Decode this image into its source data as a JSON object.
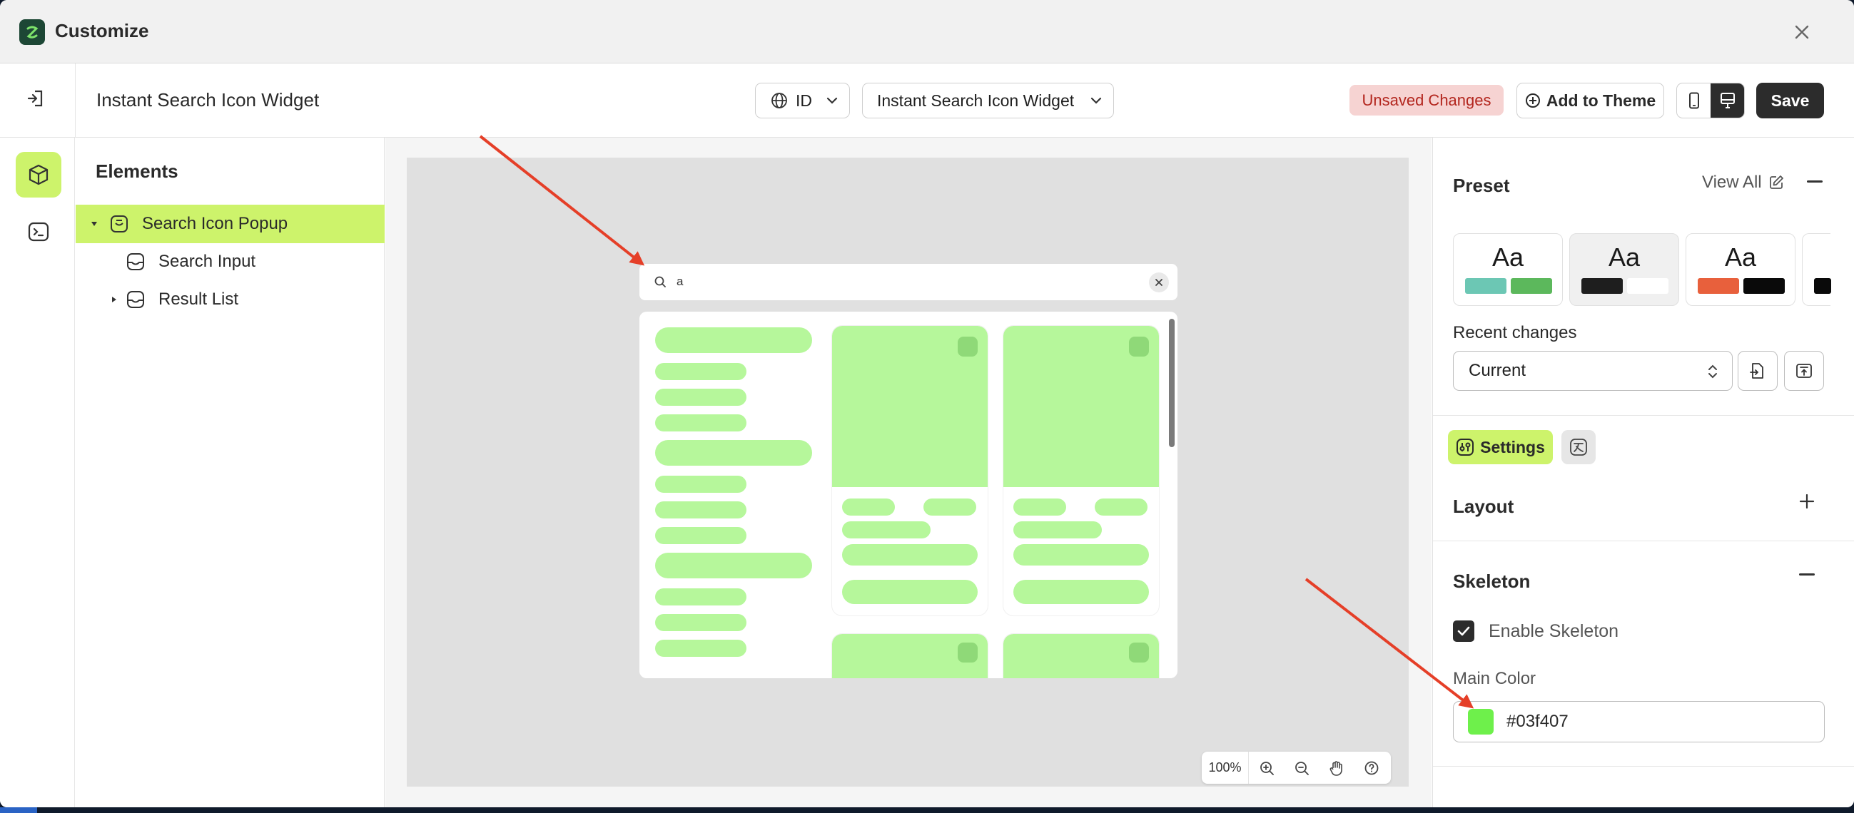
{
  "window": {
    "title": "Customize"
  },
  "header": {
    "page_name": "Instant Search Icon Widget",
    "language": "ID",
    "widget": "Instant Search Icon Widget",
    "unsaved": "Unsaved Changes",
    "add_to_theme": "Add to Theme",
    "save": "Save"
  },
  "elements": {
    "title": "Elements",
    "items": [
      {
        "label": "Search Icon Popup",
        "selected": true,
        "expanded": true
      },
      {
        "label": "Search Input"
      },
      {
        "label": "Result List",
        "collapsed": true
      }
    ]
  },
  "canvas": {
    "search_text": "a",
    "zoom": "100%",
    "skeleton_color": "#b6f79b"
  },
  "right_panel": {
    "preset_title": "Preset",
    "view_all": "View All",
    "presets": [
      {
        "label": "Aa",
        "colors": [
          "#6cc7b4",
          "#5cb85c"
        ]
      },
      {
        "label": "Aa",
        "colors": [
          "#1e1e1e",
          "#ffffff"
        ]
      },
      {
        "label": "Aa",
        "colors": [
          "#e8603c",
          "#0a0a0a"
        ]
      },
      {
        "label": "",
        "colors": [
          "#0a0a0a"
        ]
      }
    ],
    "recent_changes_label": "Recent changes",
    "recent_changes_value": "Current",
    "settings_tab": "Settings",
    "layout_title": "Layout",
    "skeleton_title": "Skeleton",
    "enable_skeleton": "Enable Skeleton",
    "main_color_label": "Main Color",
    "main_color_value": "#03f407"
  },
  "colors": {
    "accent": "#cdf36b",
    "annotation_arrow": "#e53f28"
  }
}
